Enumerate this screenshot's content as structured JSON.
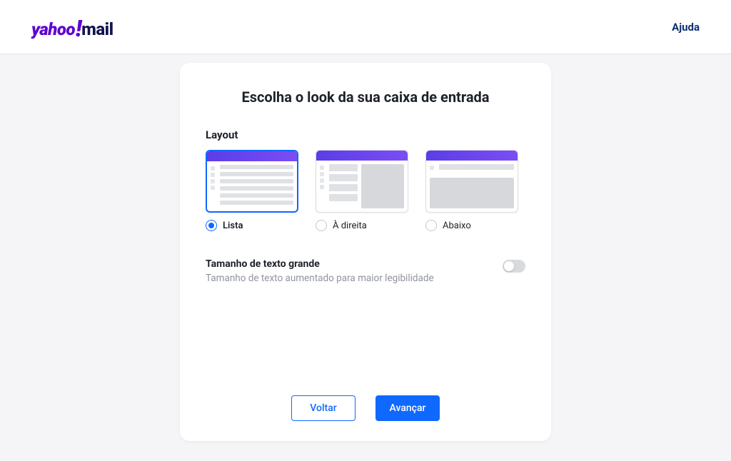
{
  "header": {
    "logo_yahoo": "yahoo",
    "logo_bang": "!",
    "logo_mail": "mail",
    "help_label": "Ajuda"
  },
  "card": {
    "title": "Escolha o look da sua caixa de entrada",
    "layout_section_label": "Layout",
    "options": [
      {
        "id": "list",
        "label": "Lista",
        "selected": true
      },
      {
        "id": "right",
        "label": "À direita",
        "selected": false
      },
      {
        "id": "below",
        "label": "Abaixo",
        "selected": false
      }
    ],
    "large_text": {
      "title": "Tamanho de texto grande",
      "desc": "Tamanho de texto aumentado para maior legibilidade",
      "enabled": false
    },
    "buttons": {
      "back": "Voltar",
      "next": "Avançar"
    }
  }
}
